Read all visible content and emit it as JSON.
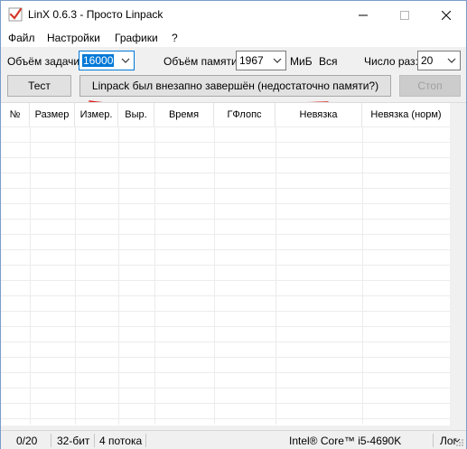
{
  "window": {
    "title": "LinX 0.6.3 - Просто Linpack"
  },
  "menu": {
    "items": [
      "Файл",
      "Настройки",
      "Графики",
      "?"
    ]
  },
  "controls": {
    "task_size_label": "Объём задачи:",
    "task_size_value": "16000",
    "memory_label": "Объём памяти:",
    "memory_value": "1967",
    "memory_unit": "МиБ",
    "memory_all": "Вся",
    "runs_label": "Число раз:",
    "runs_value": "20"
  },
  "buttons": {
    "test": "Тест",
    "status": "Linpack был внезапно завершён (недостаточно памяти?)",
    "stop": "Стоп"
  },
  "table": {
    "columns": [
      "№",
      "Размер",
      "Измер.",
      "Выр.",
      "Время",
      "ГФлопс",
      "Невязка",
      "Невязка (норм)"
    ],
    "rows": []
  },
  "statusbar": {
    "progress": "0/20",
    "bitness": "32-бит",
    "threads": "4 потока",
    "cpu": "Intel® Core™ i5-4690K",
    "log": "Лог"
  },
  "colors": {
    "accent": "#0078d7",
    "underline": "#e0201b"
  }
}
